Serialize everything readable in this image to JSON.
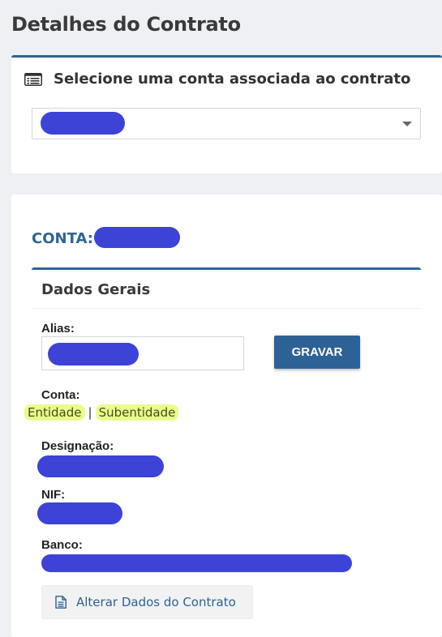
{
  "page": {
    "title": "Detalhes do Contrato"
  },
  "account_select": {
    "header_icon": "list-icon",
    "title": "Selecione uma conta associada ao contrato",
    "selected_value_redacted": true
  },
  "account_detail": {
    "title_label": "CONTA:",
    "box_title": "Dados Gerais",
    "alias_label": "Alias:",
    "save_label": "GRAVAR",
    "conta_label": "Conta:",
    "conta_links": {
      "entidade": "Entidade",
      "separator": "|",
      "subentidade": "Subentidade"
    },
    "designacao_label": "Designação:",
    "nif_label": "NIF:",
    "banco_label": "Banco:",
    "alterar_label": "Alterar Dados do Contrato",
    "alterar_icon": "document-icon"
  },
  "colors": {
    "accent": "#2f6496",
    "redaction": "#3d43d6",
    "highlight": "#eafc8c",
    "background": "#eef0f4"
  }
}
